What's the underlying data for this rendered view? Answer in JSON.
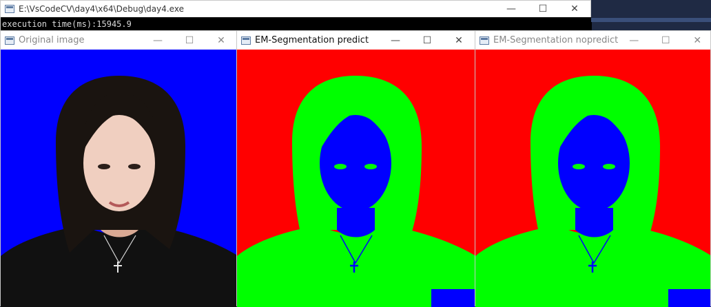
{
  "console": {
    "title": "E:\\VsCodeCV\\day4\\x64\\Debug\\day4.exe",
    "output_line": "execution time(ms):15945.9",
    "minimize": "—",
    "maximize": "☐",
    "close": "✕"
  },
  "windows": [
    {
      "title": "Original image",
      "minimize": "—",
      "maximize": "☐",
      "close": "✕"
    },
    {
      "title": "EM-Segmentation predict",
      "minimize": "—",
      "maximize": "☐",
      "close": "✕"
    },
    {
      "title": "EM-Segmentation nopredict",
      "minimize": "—",
      "maximize": "☐",
      "close": "✕"
    }
  ],
  "colors": {
    "original_background": "#0000ff",
    "seg_background": "#ff0000",
    "seg_hair_body": "#00ff00",
    "seg_face": "#0000ff"
  }
}
